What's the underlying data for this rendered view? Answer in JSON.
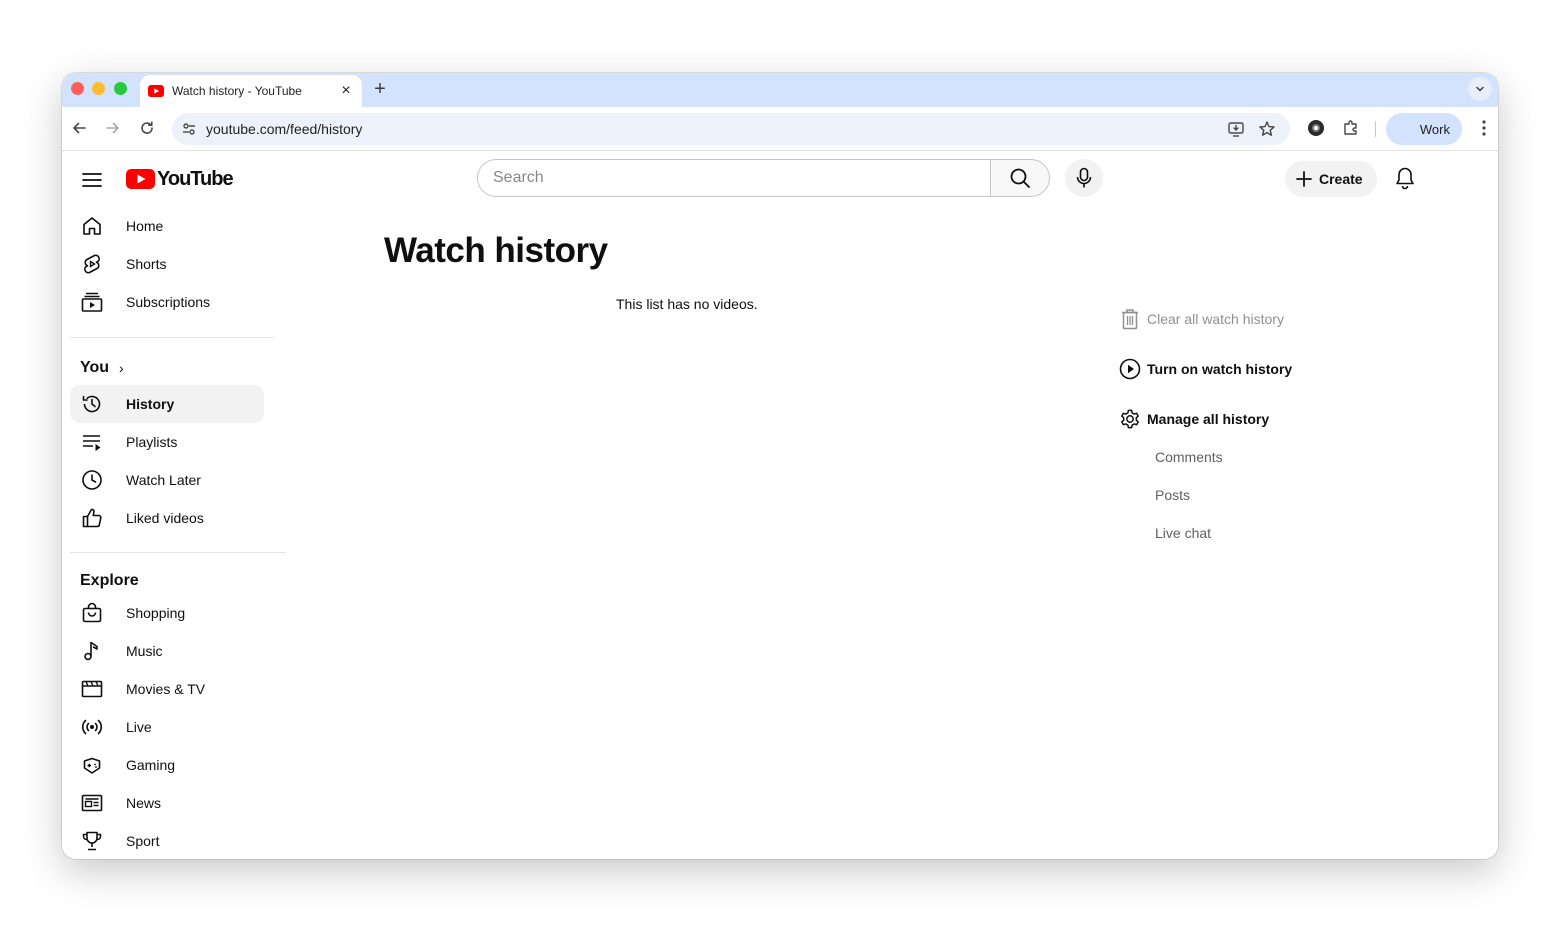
{
  "browser": {
    "tab_title": "Watch history - YouTube",
    "new_tab_symbol": "+",
    "close_symbol": "×",
    "url": "youtube.com/feed/history",
    "profile_label": "Work",
    "icons": [
      "back-arrow-icon",
      "forward-arrow-icon",
      "reload-icon",
      "site-settings-icon",
      "install-app-icon",
      "bookmark-star-icon",
      "extension-avatar-icon",
      "extensions-puzzle-icon",
      "more-vert-icon",
      "tab-search-chevron-icon"
    ]
  },
  "masthead": {
    "brand": "YouTube",
    "search_placeholder": "Search",
    "create_label": "Create",
    "brand_color": "#ff0000"
  },
  "sidebar": {
    "primary": [
      {
        "label": "Home",
        "icon": "home-icon"
      },
      {
        "label": "Shorts",
        "icon": "shorts-icon"
      },
      {
        "label": "Subscriptions",
        "icon": "subscriptions-icon"
      }
    ],
    "you_heading": "You",
    "you_chevron": "›",
    "you_items": [
      {
        "label": "History",
        "icon": "history-icon",
        "active": true
      },
      {
        "label": "Playlists",
        "icon": "playlists-icon"
      },
      {
        "label": "Watch Later",
        "icon": "clock-icon"
      },
      {
        "label": "Liked videos",
        "icon": "thumbs-up-icon"
      }
    ],
    "explore_heading": "Explore",
    "explore_items": [
      {
        "label": "Shopping",
        "icon": "shopping-bag-icon"
      },
      {
        "label": "Music",
        "icon": "music-note-icon"
      },
      {
        "label": "Movies & TV",
        "icon": "clapperboard-icon"
      },
      {
        "label": "Live",
        "icon": "live-broadcast-icon"
      },
      {
        "label": "Gaming",
        "icon": "gamepad-icon"
      },
      {
        "label": "News",
        "icon": "newspaper-icon"
      },
      {
        "label": "Sport",
        "icon": "trophy-icon"
      }
    ]
  },
  "main": {
    "title": "Watch history",
    "empty_message": "This list has no videos."
  },
  "history_actions": {
    "clear": "Clear all watch history",
    "turn_on": "Turn on watch history",
    "manage": "Manage all history",
    "sub_items": [
      "Comments",
      "Posts",
      "Live chat"
    ]
  }
}
